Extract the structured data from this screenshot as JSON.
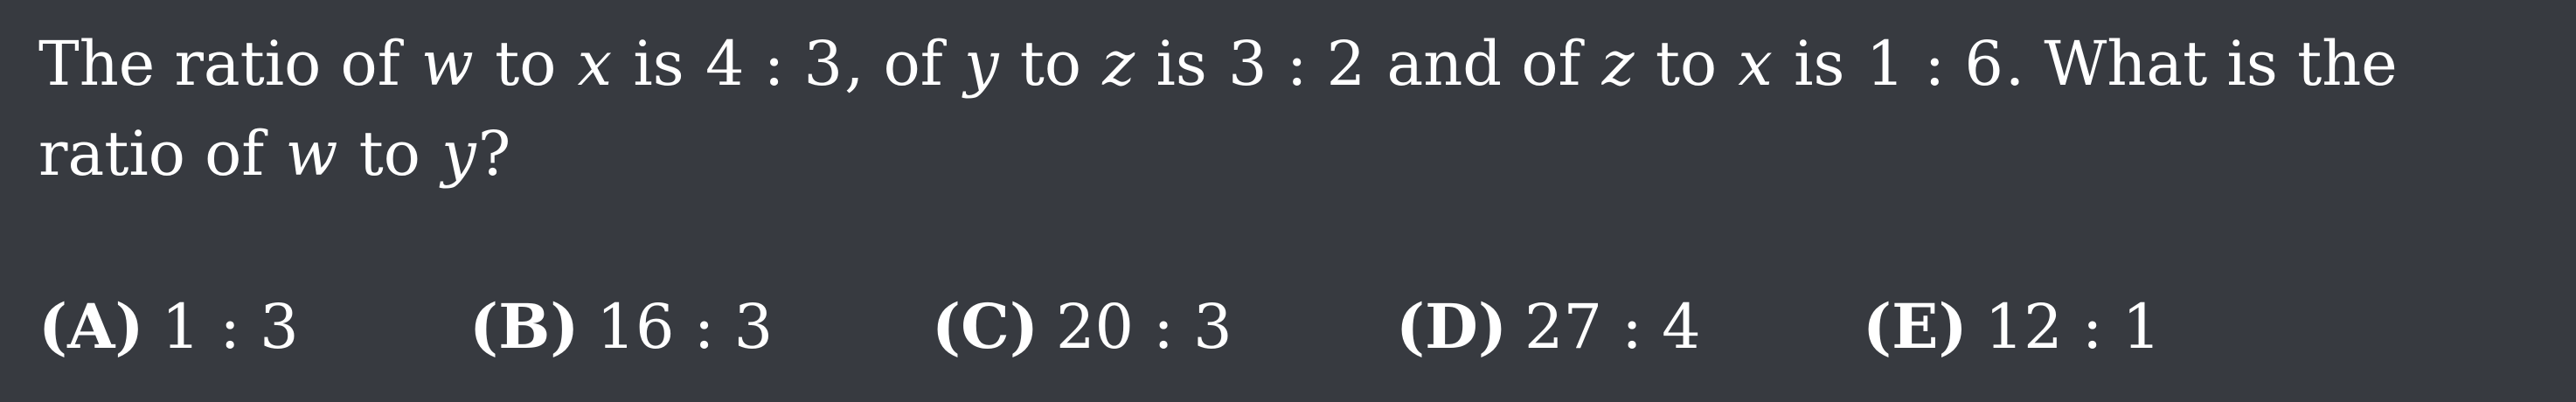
{
  "question": {
    "p1": "The ratio of",
    "v_w": "w",
    "p2": "to",
    "v_x": "x",
    "p3": "is",
    "r1": "4 : 3",
    "p4": ", of",
    "v_y": "y",
    "p5": "to",
    "v_z": "z",
    "p6": "is",
    "r2": "3 : 2",
    "p7": "and of",
    "v_z2": "z",
    "p8": "to",
    "v_x2": "x",
    "p9": "is",
    "r3": "1 : 6",
    "p10": ". What is the ratio of",
    "v_w2": "w",
    "p11": "to",
    "v_y2": "y",
    "p12": "?"
  },
  "choices": [
    {
      "letter": "(A)",
      "value": "1 : 3"
    },
    {
      "letter": "(B)",
      "value": "16 : 3"
    },
    {
      "letter": "(C)",
      "value": "20 : 3"
    },
    {
      "letter": "(D)",
      "value": "27 : 4"
    },
    {
      "letter": "(E)",
      "value": "12 : 1"
    }
  ]
}
